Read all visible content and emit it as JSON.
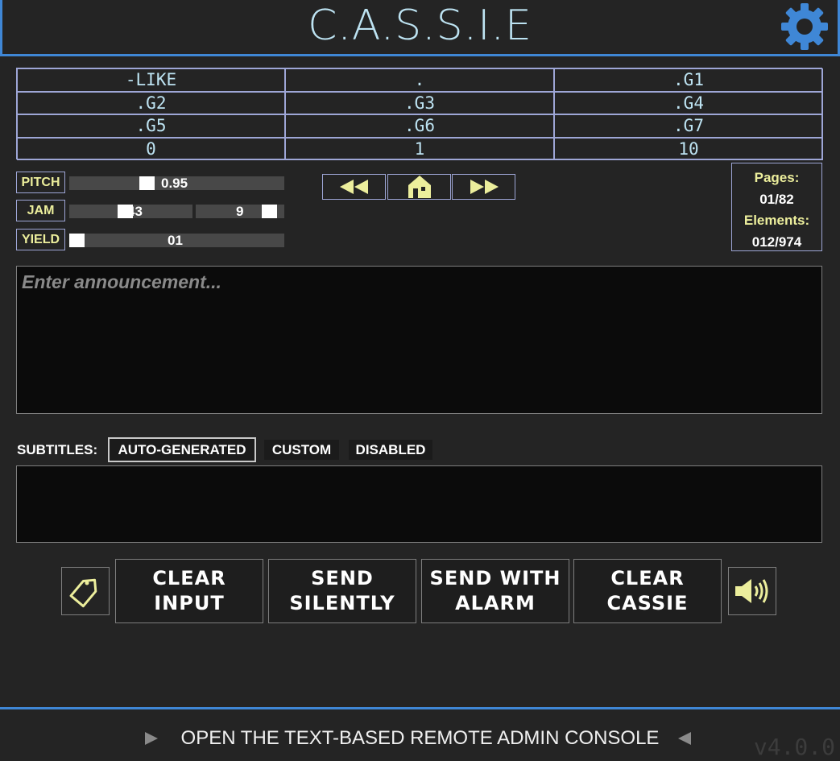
{
  "header": {
    "title": "C.A.S.S.I.E",
    "settings_icon": "gear-icon"
  },
  "grid": {
    "cells": [
      "-LIKE",
      ".",
      ".G1",
      ".G2",
      ".G3",
      ".G4",
      ".G5",
      ".G6",
      ".G7",
      "0",
      "1",
      "10"
    ]
  },
  "sliders": {
    "pitch": {
      "label": "PITCH",
      "value": "0.95",
      "level": 0.35
    },
    "jam": {
      "label": "JAM",
      "value_a": "43",
      "value_b": "9",
      "level_a": 0.45,
      "level_b": 0.9
    },
    "yield": {
      "label": "YIELD",
      "value": "01",
      "level": 0.0
    }
  },
  "nav": {
    "prev_icon": "rewind-icon",
    "home_icon": "home-icon",
    "next_icon": "fast-forward-icon"
  },
  "pages": {
    "pages_label": "Pages:",
    "pages_value": "01/82",
    "elements_label": "Elements:",
    "elements_value": "012/974"
  },
  "announcement": {
    "placeholder": "Enter announcement..."
  },
  "subtitles": {
    "label": "SUBTITLES:",
    "options": [
      "AUTO-GENERATED",
      "CUSTOM",
      "DISABLED"
    ],
    "selected": "AUTO-GENERATED"
  },
  "actions": {
    "clear_input": "CLEAR\nINPUT",
    "send_silently": "SEND\nSILENTLY",
    "send_with_alarm": "SEND WITH\nALARM",
    "clear_cassie": "CLEAR\nCASSIE",
    "left_icon": "tag-icon",
    "right_icon": "speaker-icon"
  },
  "footer": {
    "console_link": "OPEN THE TEXT-BASED REMOTE ADMIN CONSOLE",
    "version": "v4.0.0"
  },
  "colors": {
    "accent": "#3f87d6",
    "title": "#bde3f2",
    "highlight": "#ecee9c",
    "border": "#9ea6d6"
  }
}
